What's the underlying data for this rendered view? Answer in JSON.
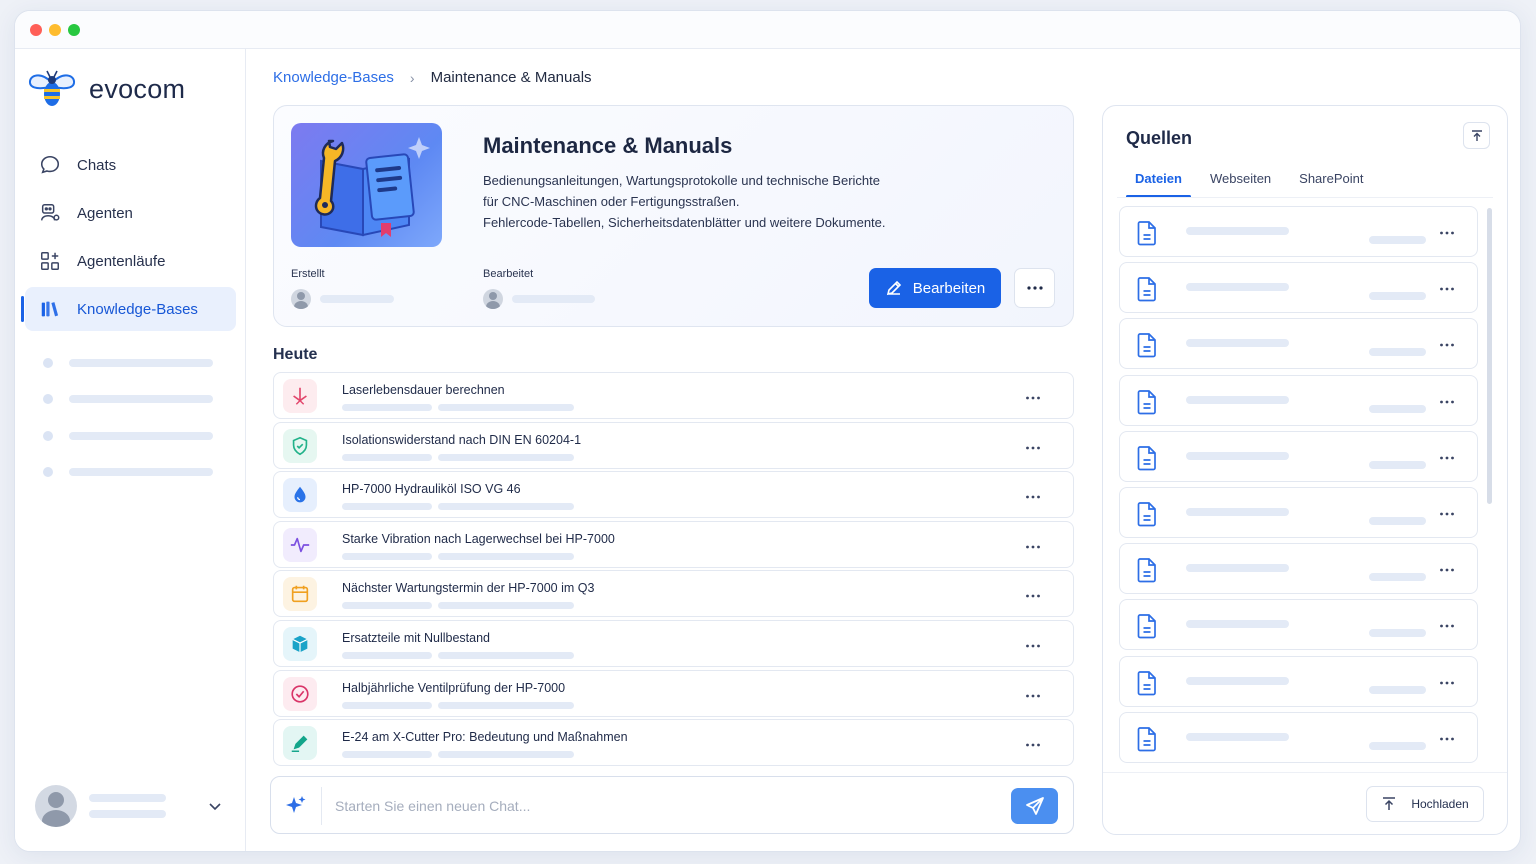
{
  "brand": {
    "name": "evocom"
  },
  "nav": {
    "items": [
      {
        "label": "Chats",
        "icon": "chat-bubble-icon"
      },
      {
        "label": "Agenten",
        "icon": "agent-icon"
      },
      {
        "label": "Agentenläufe",
        "icon": "workflow-icon"
      },
      {
        "label": "Knowledge-Bases",
        "icon": "books-icon",
        "active": true
      }
    ]
  },
  "breadcrumb": {
    "parent": "Knowledge-Bases",
    "separator": "›",
    "current": "Maintenance & Manuals"
  },
  "knowledge_base": {
    "title": "Maintenance & Manuals",
    "description": [
      "Bedienungsanleitungen, Wartungsprotokolle und technische Berichte",
      "für CNC-Maschinen oder Fertigungsstraßen.",
      "Fehlercode-Tabellen, Sicherheitsdatenblätter und weitere Dokumente."
    ],
    "created_label": "Erstellt",
    "edited_label": "Bearbeitet",
    "edit_button": "Bearbeiten"
  },
  "today": {
    "title": "Heute",
    "chats": [
      {
        "title": "Laserlebensdauer berechnen",
        "icon": "laser-icon",
        "bg": "#fdecef",
        "color": "#e2456b"
      },
      {
        "title": "Isolationswiderstand nach DIN EN 60204-1",
        "icon": "shield-icon",
        "bg": "#e6f7f1",
        "color": "#22b28a"
      },
      {
        "title": "HP-7000 Hydrauliköl ISO VG 46",
        "icon": "drop-icon",
        "bg": "#e6effd",
        "color": "#2a73e8"
      },
      {
        "title": "Starke Vibration nach Lagerwechsel bei HP-7000",
        "icon": "pulse-icon",
        "bg": "#f1ecfd",
        "color": "#7b4fe0"
      },
      {
        "title": "Nächster Wartungstermin der HP-7000 im Q3",
        "icon": "calendar-icon",
        "bg": "#fdf3e2",
        "color": "#f0a020"
      },
      {
        "title": "Ersatzteile mit Nullbestand",
        "icon": "box-icon",
        "bg": "#e5f5fa",
        "color": "#1aa3c8"
      },
      {
        "title": "Halbjährliche Ventilprüfung der HP-7000",
        "icon": "check-circle-icon",
        "bg": "#fdebf0",
        "color": "#d93468"
      },
      {
        "title": "E-24 am X-Cutter Pro: Bedeutung und Maßnahmen",
        "icon": "pen-icon",
        "bg": "#e3f6f3",
        "color": "#13a58a"
      }
    ]
  },
  "chat_input": {
    "placeholder": "Starten Sie einen neuen Chat..."
  },
  "sources": {
    "title": "Quellen",
    "tabs": [
      "Dateien",
      "Webseiten",
      "SharePoint"
    ],
    "active_tab": "Dateien",
    "upload_button": "Hochladen"
  },
  "colors": {
    "accent": "#1a62e6",
    "active_bg": "#e9f0fd",
    "skeleton": "#e3eaf6"
  }
}
